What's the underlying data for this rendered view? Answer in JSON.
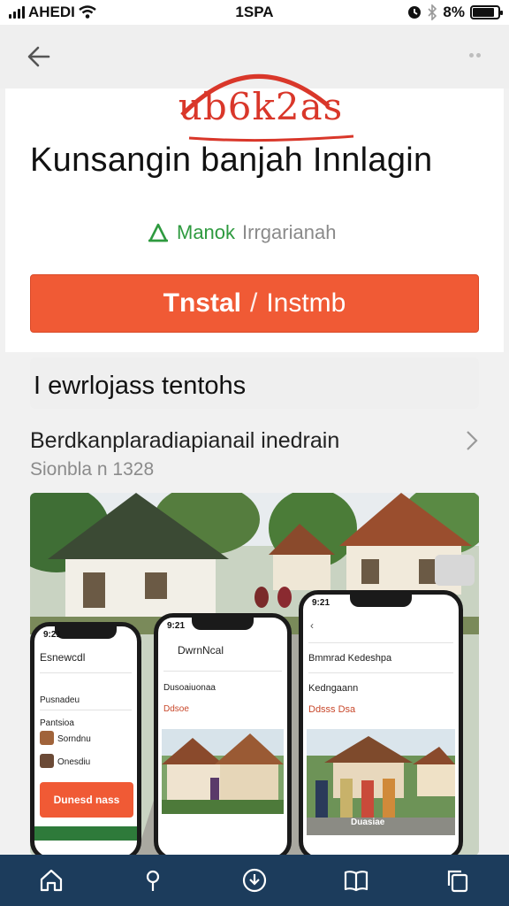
{
  "status_bar": {
    "carrier": "AHEDI",
    "time": "1SPA",
    "battery": "8%",
    "battery_level": 0.85
  },
  "nav": {
    "back_icon": "back-arrow-icon",
    "more_icon": "more-dots-icon"
  },
  "app": {
    "logo_text": "ub6k2as",
    "title": "Kunsangin banjah Innlagin",
    "developer": "Manok",
    "developer_org": "Irrgarianah",
    "install_label": "Tnstal",
    "install_sep": "/",
    "install_secondary": "Instmb",
    "accent_color": "#f05a35",
    "developer_color": "#2e9a3f"
  },
  "about": {
    "header": "I ewrlojass tentohs",
    "description": "Berdkanplaradiapianail inedrain",
    "meta": "Sionbla n 1328"
  },
  "screens": {
    "left": {
      "time": "9:21",
      "title": "Esnewcdl",
      "items": [
        "Pusnadeu",
        "Pantsioa",
        "Sorndnu",
        "Onesdiu"
      ],
      "button": "Dunesd nass"
    },
    "middle": {
      "time": "9:21",
      "title": "DwrnNcal",
      "subtitle": "Dusoaiuonaa",
      "dots": "Ddsoe"
    },
    "right": {
      "time": "9:21",
      "row1": "Bmmrad Kedeshpa",
      "row2": "Kedngaann",
      "row3": "Ddsss Dsa",
      "caption": "Duasiae"
    }
  },
  "bottom_nav": {
    "items": [
      "home-icon",
      "location-pin-icon",
      "download-icon",
      "book-icon",
      "copy-icon"
    ],
    "background": "#1c3c5c"
  }
}
